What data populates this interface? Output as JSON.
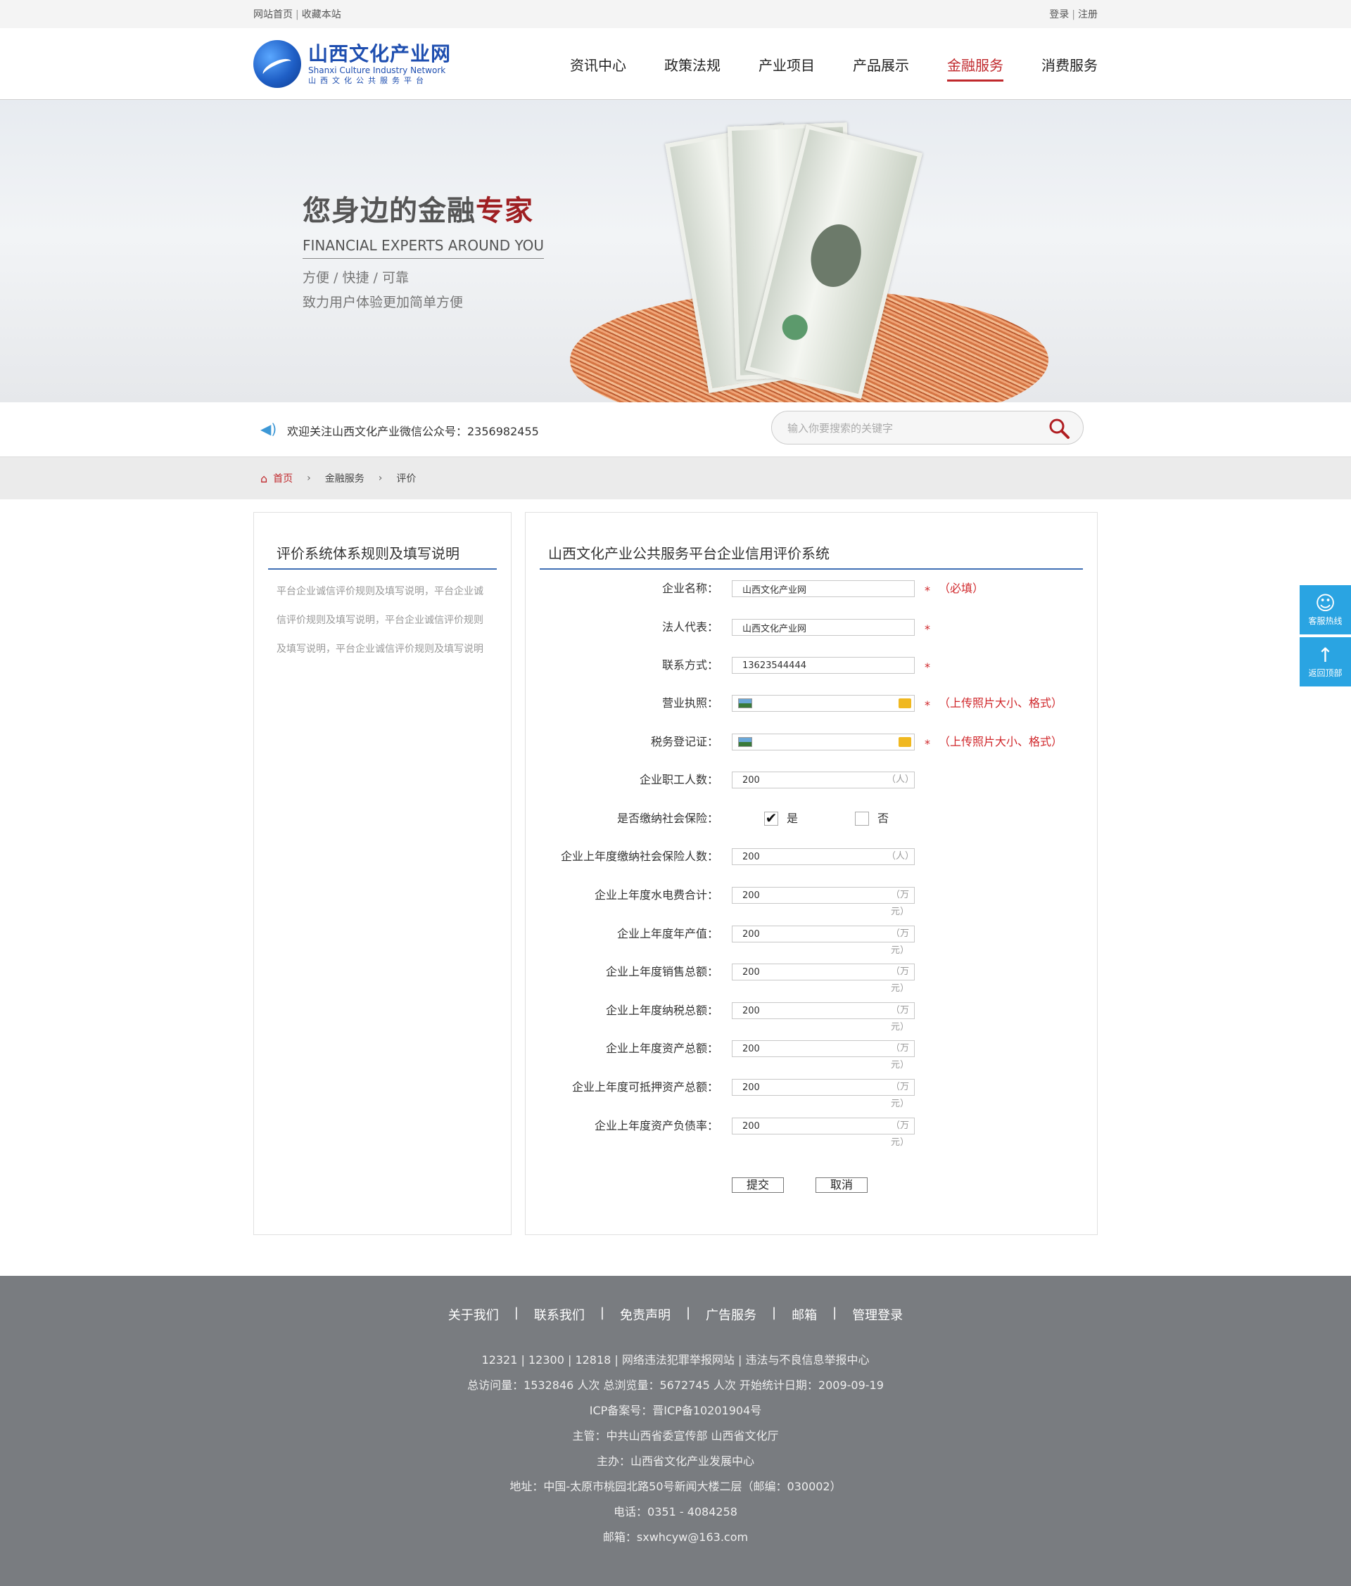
{
  "topbar": {
    "home": "网站首页",
    "sep": "|",
    "bookmark": "收藏本站",
    "login": "登录",
    "register": "注册"
  },
  "logo": {
    "cn": "山西文化产业网",
    "en": "Shanxi Culture Industry Network",
    "sub": "山西文化公共服务平台"
  },
  "nav": [
    "资讯中心",
    "政策法规",
    "产业项目",
    "产品展示",
    "金融服务",
    "消费服务"
  ],
  "nav_active": "金融服务",
  "banner": {
    "title_a": "您身边的金融",
    "title_b": "专家",
    "subtitle": "FINANCIAL EXPERTS AROUND YOU",
    "line1": "方便 / 快捷 / 可靠",
    "line2": "致力用户体验更加简单方便"
  },
  "notice": "欢迎关注山西文化产业微信公众号：2356982455",
  "search": {
    "placeholder": "输入你要搜索的关键字"
  },
  "breadcrumb": {
    "home": "首页",
    "level1": "金融服务",
    "level2": "评价"
  },
  "sidebar": {
    "title": "评价系统体系规则及填写说明",
    "text": "平台企业诚信评价规则及填写说明，平台企业诚信评价规则及填写说明，平台企业诚信评价规则及填写说明，平台企业诚信评价规则及填写说明"
  },
  "form": {
    "title": "山西文化产业公共服务平台企业信用评价系统",
    "required_mark": "*",
    "company_name": {
      "label": "企业名称：",
      "value": "山西文化产业网",
      "note": "（必填）"
    },
    "legal_rep": {
      "label": "法人代表：",
      "value": "山西文化产业网"
    },
    "contact": {
      "label": "联系方式：",
      "value": "13623544444"
    },
    "license": {
      "label": "营业执照：",
      "note": "（上传照片大小、格式）"
    },
    "tax_cert": {
      "label": "税务登记证：",
      "note": "（上传照片大小、格式）"
    },
    "staff": {
      "label": "企业职工人数：",
      "value": "200",
      "unit": "（人）"
    },
    "insurance": {
      "label": "是否缴纳社会保险：",
      "yes": "是",
      "no": "否",
      "yes_checked": "✔"
    },
    "insured": {
      "label": "企业上年度缴纳社会保险人数：",
      "value": "200",
      "unit": "（人）"
    },
    "utility": {
      "label": "企业上年度水电费合计：",
      "value": "200",
      "unit": "（万元）"
    },
    "output": {
      "label": "企业上年度年产值：",
      "value": "200",
      "unit": "（万元）"
    },
    "sales": {
      "label": "企业上年度销售总额：",
      "value": "200",
      "unit": "（万元）"
    },
    "tax": {
      "label": "企业上年度纳税总额：",
      "value": "200",
      "unit": "（万元）"
    },
    "assets": {
      "label": "企业上年度资产总额：",
      "value": "200",
      "unit": "（万元）"
    },
    "mortgage": {
      "label": "企业上年度可抵押资产总额：",
      "value": "200",
      "unit": "（万元）"
    },
    "debt_ratio": {
      "label": "企业上年度资产负债率：",
      "value": "200",
      "unit": "（万元）"
    },
    "submit": "提交",
    "cancel": "取消"
  },
  "floatbar": {
    "hotline": "客服热线",
    "top": "返回顶部"
  },
  "footer": {
    "links": [
      "关于我们",
      "联系我们",
      "免责声明",
      "广告服务",
      "邮箱",
      "管理登录"
    ],
    "link_sep": "|",
    "lines": [
      "12321 | 12300 | 12818 | 网络违法犯罪举报网站 | 违法与不良信息举报中心",
      "总访问量：1532846 人次  总浏览量：5672745 人次  开始统计日期：2009-09-19",
      "ICP备案号：晋ICP备10201904号",
      "主管：中共山西省委宣传部 山西省文化厅",
      "主办：山西省文化产业发展中心",
      "地址：中国-太原市桃园北路50号新闻大楼二层（邮编：030002）",
      "电话：0351 - 4084258",
      "邮箱：sxwhcyw@163.com"
    ]
  },
  "colors": {
    "accent": "#c0282c",
    "blue_line": "#3f6fb5",
    "float": "#2aa4e2",
    "footer_bg": "#797c80"
  }
}
